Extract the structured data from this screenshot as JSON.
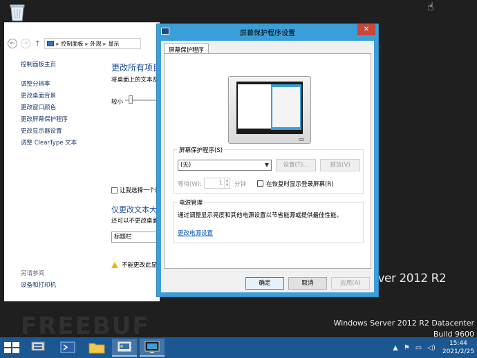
{
  "window_title": "屏幕保护程序设置",
  "close_glyph": "✕",
  "tab_label": "屏幕保护程序",
  "screensaver": {
    "group_label": "屏幕保护程序(S)",
    "selected": "(无)",
    "settings_button": "设置(T)...",
    "preview_button": "预览(V)",
    "wait_label": "等待(W):",
    "wait_value": "1",
    "minutes_label": "分钟",
    "resume_label": "在恢复时显示登录屏幕(R)"
  },
  "power": {
    "group_label": "电源管理",
    "description": "通过调整显示亮度和其他电源设置以节省能源或提供最佳性能。",
    "link": "更改电源设置"
  },
  "buttons": {
    "ok": "确定",
    "cancel": "取消",
    "apply": "应用(A)"
  },
  "control_panel": {
    "breadcrumbs": [
      "控制面板",
      "外观",
      "显示"
    ],
    "home": "控制面板主页",
    "links": [
      "调整分辨率",
      "更改桌面背景",
      "更改窗口颜色",
      "更改屏幕保护程序",
      "更改显示器设置",
      "调整 ClearType 文本"
    ],
    "see_also": "另请参阅",
    "devices": "设备和打印机",
    "heading": "更改所有项目",
    "subtext": "将桌面上的文本及",
    "small_label": "较小",
    "let_me_choose": "让我选择一个适",
    "heading2": "仅更改文本大",
    "note": "还可以不更改桌面",
    "combo_value": "标题栏",
    "warning": "不能更改此显示"
  },
  "desktop": {
    "brand": "rver 2012 R2",
    "watermark_line1": "Windows Server 2012 R2 Datacenter",
    "watermark_line2": "Build 9600",
    "freebuf": "FREEBUF"
  },
  "taskbar": {
    "time": "15:44",
    "date": "2021/2/25"
  },
  "colors": {
    "taskbar": "#1b5793",
    "dialog_frame": "#3a9fd8",
    "link": "#0b58b5",
    "close": "#c7473b"
  }
}
